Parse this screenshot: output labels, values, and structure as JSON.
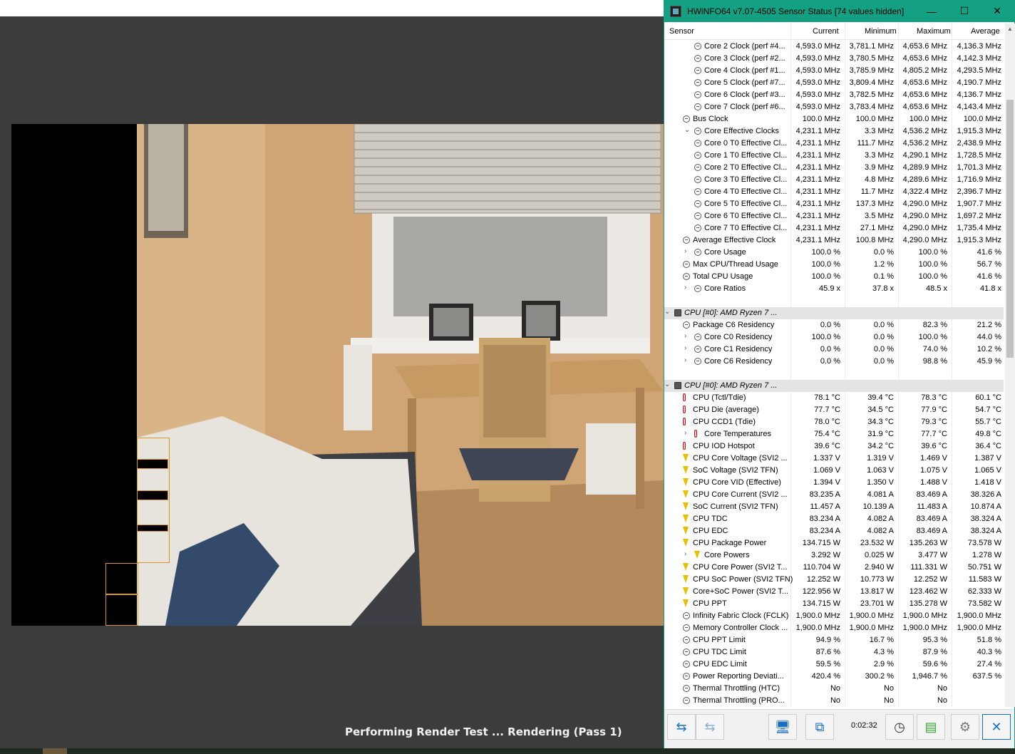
{
  "render": {
    "status_text": "Performing Render Test ... Rendering (Pass 1)"
  },
  "hwinfo": {
    "title": "HWiNFO64 v7.07-4505 Sensor Status [74 values hidden]",
    "window_controls": {
      "minimize": "—",
      "maximize": "☐",
      "close": "✕"
    },
    "columns": [
      "Sensor",
      "Current",
      "Minimum",
      "Maximum",
      "Average"
    ],
    "rows": [
      {
        "name": "Core 2 Clock (perf #4...",
        "cur": "4,593.0 MHz",
        "min": "3,781.1 MHz",
        "max": "4,653.6 MHz",
        "avg": "4,136.3 MHz",
        "indent": 2,
        "icon": "circle"
      },
      {
        "name": "Core 3 Clock (perf #2...",
        "cur": "4,593.0 MHz",
        "min": "3,780.5 MHz",
        "max": "4,653.6 MHz",
        "avg": "4,142.3 MHz",
        "indent": 2,
        "icon": "circle"
      },
      {
        "name": "Core 4 Clock (perf #1...",
        "cur": "4,593.0 MHz",
        "min": "3,785.9 MHz",
        "max": "4,805.2 MHz",
        "avg": "4,293.5 MHz",
        "indent": 2,
        "icon": "circle"
      },
      {
        "name": "Core 5 Clock (perf #7...",
        "cur": "4,593.0 MHz",
        "min": "3,809.4 MHz",
        "max": "4,653.6 MHz",
        "avg": "4,190.7 MHz",
        "indent": 2,
        "icon": "circle"
      },
      {
        "name": "Core 6 Clock (perf #3...",
        "cur": "4,593.0 MHz",
        "min": "3,782.5 MHz",
        "max": "4,653.6 MHz",
        "avg": "4,136.7 MHz",
        "indent": 2,
        "icon": "circle"
      },
      {
        "name": "Core 7 Clock (perf #6...",
        "cur": "4,593.0 MHz",
        "min": "3,783.4 MHz",
        "max": "4,653.6 MHz",
        "avg": "4,143.4 MHz",
        "indent": 2,
        "icon": "circle"
      },
      {
        "name": "Bus Clock",
        "cur": "100.0 MHz",
        "min": "100.0 MHz",
        "max": "100.0 MHz",
        "avg": "100.0 MHz",
        "indent": 1,
        "icon": "circle"
      },
      {
        "name": "Core Effective Clocks",
        "cur": "4,231.1 MHz",
        "min": "3.3 MHz",
        "max": "4,536.2 MHz",
        "avg": "1,915.3 MHz",
        "indent": 2,
        "icon": "circle",
        "exp": "⌄"
      },
      {
        "name": "Core 0 T0 Effective Cl...",
        "cur": "4,231.1 MHz",
        "min": "111.7 MHz",
        "max": "4,536.2 MHz",
        "avg": "2,438.9 MHz",
        "indent": 2,
        "icon": "circle"
      },
      {
        "name": "Core 1 T0 Effective Cl...",
        "cur": "4,231.1 MHz",
        "min": "3.3 MHz",
        "max": "4,290.1 MHz",
        "avg": "1,728.5 MHz",
        "indent": 2,
        "icon": "circle"
      },
      {
        "name": "Core 2 T0 Effective Cl...",
        "cur": "4,231.1 MHz",
        "min": "3.9 MHz",
        "max": "4,289.9 MHz",
        "avg": "1,701.3 MHz",
        "indent": 2,
        "icon": "circle"
      },
      {
        "name": "Core 3 T0 Effective Cl...",
        "cur": "4,231.1 MHz",
        "min": "4.8 MHz",
        "max": "4,289.6 MHz",
        "avg": "1,716.9 MHz",
        "indent": 2,
        "icon": "circle"
      },
      {
        "name": "Core 4 T0 Effective Cl...",
        "cur": "4,231.1 MHz",
        "min": "11.7 MHz",
        "max": "4,322.4 MHz",
        "avg": "2,396.7 MHz",
        "indent": 2,
        "icon": "circle"
      },
      {
        "name": "Core 5 T0 Effective Cl...",
        "cur": "4,231.1 MHz",
        "min": "137.3 MHz",
        "max": "4,290.0 MHz",
        "avg": "1,907.7 MHz",
        "indent": 2,
        "icon": "circle"
      },
      {
        "name": "Core 6 T0 Effective Cl...",
        "cur": "4,231.1 MHz",
        "min": "3.5 MHz",
        "max": "4,290.0 MHz",
        "avg": "1,697.2 MHz",
        "indent": 2,
        "icon": "circle"
      },
      {
        "name": "Core 7 T0 Effective Cl...",
        "cur": "4,231.1 MHz",
        "min": "27.1 MHz",
        "max": "4,290.0 MHz",
        "avg": "1,735.4 MHz",
        "indent": 2,
        "icon": "circle"
      },
      {
        "name": "Average Effective Clock",
        "cur": "4,231.1 MHz",
        "min": "100.8 MHz",
        "max": "4,290.0 MHz",
        "avg": "1,915.3 MHz",
        "indent": 1,
        "icon": "circle"
      },
      {
        "name": "Core Usage",
        "cur": "100.0 %",
        "min": "0.0 %",
        "max": "100.0 %",
        "avg": "41.6 %",
        "indent": 2,
        "icon": "circle",
        "exp": "›"
      },
      {
        "name": "Max CPU/Thread Usage",
        "cur": "100.0 %",
        "min": "1.2 %",
        "max": "100.0 %",
        "avg": "56.7 %",
        "indent": 1,
        "icon": "circle"
      },
      {
        "name": "Total CPU Usage",
        "cur": "100.0 %",
        "min": "0.1 %",
        "max": "100.0 %",
        "avg": "41.6 %",
        "indent": 1,
        "icon": "circle"
      },
      {
        "name": "Core Ratios",
        "cur": "45.9 x",
        "min": "37.8 x",
        "max": "48.5 x",
        "avg": "41.8 x",
        "indent": 2,
        "icon": "circle",
        "exp": "›"
      },
      {
        "name": "",
        "cur": "",
        "min": "",
        "max": "",
        "avg": "",
        "indent": 0,
        "icon": "none"
      },
      {
        "name": "CPU [#0]: AMD Ryzen 7 ...",
        "cur": "",
        "min": "",
        "max": "",
        "avg": "",
        "indent": 0,
        "icon": "chip",
        "exp": "⌄",
        "group": true
      },
      {
        "name": "Package C6 Residency",
        "cur": "0.0 %",
        "min": "0.0 %",
        "max": "82.3 %",
        "avg": "21.2 %",
        "indent": 1,
        "icon": "circle"
      },
      {
        "name": "Core C0 Residency",
        "cur": "100.0 %",
        "min": "0.0 %",
        "max": "100.0 %",
        "avg": "44.0 %",
        "indent": 2,
        "icon": "circle",
        "exp": "›"
      },
      {
        "name": "Core C1 Residency",
        "cur": "0.0 %",
        "min": "0.0 %",
        "max": "74.0 %",
        "avg": "10.2 %",
        "indent": 2,
        "icon": "circle",
        "exp": "›"
      },
      {
        "name": "Core C6 Residency",
        "cur": "0.0 %",
        "min": "0.0 %",
        "max": "98.8 %",
        "avg": "45.9 %",
        "indent": 2,
        "icon": "circle",
        "exp": "›"
      },
      {
        "name": "",
        "cur": "",
        "min": "",
        "max": "",
        "avg": "",
        "indent": 0,
        "icon": "none"
      },
      {
        "name": "CPU [#0]: AMD Ryzen 7 ...",
        "cur": "",
        "min": "",
        "max": "",
        "avg": "",
        "indent": 0,
        "icon": "chip",
        "exp": "⌄",
        "group": true
      },
      {
        "name": "CPU (Tctl/Tdie)",
        "cur": "78.1 °C",
        "min": "39.4 °C",
        "max": "78.3 °C",
        "avg": "60.1 °C",
        "indent": 1,
        "icon": "temp"
      },
      {
        "name": "CPU Die (average)",
        "cur": "77.7 °C",
        "min": "34.5 °C",
        "max": "77.9 °C",
        "avg": "54.7 °C",
        "indent": 1,
        "icon": "temp"
      },
      {
        "name": "CPU CCD1 (Tdie)",
        "cur": "78.0 °C",
        "min": "34.3 °C",
        "max": "79.3 °C",
        "avg": "55.7 °C",
        "indent": 1,
        "icon": "temp"
      },
      {
        "name": "Core Temperatures",
        "cur": "75.4 °C",
        "min": "31.9 °C",
        "max": "77.7 °C",
        "avg": "49.8 °C",
        "indent": 2,
        "icon": "temp",
        "exp": "›"
      },
      {
        "name": "CPU IOD Hotspot",
        "cur": "39.6 °C",
        "min": "34.2 °C",
        "max": "39.6 °C",
        "avg": "36.4 °C",
        "indent": 1,
        "icon": "temp"
      },
      {
        "name": "CPU Core Voltage (SVI2 ...",
        "cur": "1.337 V",
        "min": "1.319 V",
        "max": "1.469 V",
        "avg": "1.387 V",
        "indent": 1,
        "icon": "volt"
      },
      {
        "name": "SoC Voltage (SVI2 TFN)",
        "cur": "1.069 V",
        "min": "1.063 V",
        "max": "1.075 V",
        "avg": "1.065 V",
        "indent": 1,
        "icon": "volt"
      },
      {
        "name": "CPU Core VID (Effective)",
        "cur": "1.394 V",
        "min": "1.350 V",
        "max": "1.488 V",
        "avg": "1.418 V",
        "indent": 1,
        "icon": "volt"
      },
      {
        "name": "CPU Core Current (SVI2 ...",
        "cur": "83.235 A",
        "min": "4.081 A",
        "max": "83.469 A",
        "avg": "38.326 A",
        "indent": 1,
        "icon": "volt"
      },
      {
        "name": "SoC Current (SVI2 TFN)",
        "cur": "11.457 A",
        "min": "10.139 A",
        "max": "11.483 A",
        "avg": "10.874 A",
        "indent": 1,
        "icon": "volt"
      },
      {
        "name": "CPU TDC",
        "cur": "83.234 A",
        "min": "4.082 A",
        "max": "83.469 A",
        "avg": "38.324 A",
        "indent": 1,
        "icon": "volt"
      },
      {
        "name": "CPU EDC",
        "cur": "83.234 A",
        "min": "4.082 A",
        "max": "83.469 A",
        "avg": "38.324 A",
        "indent": 1,
        "icon": "volt"
      },
      {
        "name": "CPU Package Power",
        "cur": "134.715 W",
        "min": "23.532 W",
        "max": "135.263 W",
        "avg": "73.578 W",
        "indent": 1,
        "icon": "volt"
      },
      {
        "name": "Core Powers",
        "cur": "3.292 W",
        "min": "0.025 W",
        "max": "3.477 W",
        "avg": "1.278 W",
        "indent": 2,
        "icon": "volt",
        "exp": "›"
      },
      {
        "name": "CPU Core Power (SVI2 T...",
        "cur": "110.704 W",
        "min": "2.940 W",
        "max": "111.331 W",
        "avg": "50.751 W",
        "indent": 1,
        "icon": "volt"
      },
      {
        "name": "CPU SoC Power (SVI2 TFN)",
        "cur": "12.252 W",
        "min": "10.773 W",
        "max": "12.252 W",
        "avg": "11.583 W",
        "indent": 1,
        "icon": "volt"
      },
      {
        "name": "Core+SoC Power (SVI2 T...",
        "cur": "122.956 W",
        "min": "13.817 W",
        "max": "123.462 W",
        "avg": "62.333 W",
        "indent": 1,
        "icon": "volt"
      },
      {
        "name": "CPU PPT",
        "cur": "134.715 W",
        "min": "23.701 W",
        "max": "135.278 W",
        "avg": "73.582 W",
        "indent": 1,
        "icon": "volt"
      },
      {
        "name": "Infinity Fabric Clock (FCLK)",
        "cur": "1,900.0 MHz",
        "min": "1,900.0 MHz",
        "max": "1,900.0 MHz",
        "avg": "1,900.0 MHz",
        "indent": 1,
        "icon": "circle"
      },
      {
        "name": "Memory Controller Clock ...",
        "cur": "1,900.0 MHz",
        "min": "1,900.0 MHz",
        "max": "1,900.0 MHz",
        "avg": "1,900.0 MHz",
        "indent": 1,
        "icon": "circle"
      },
      {
        "name": "CPU PPT Limit",
        "cur": "94.9 %",
        "min": "16.7 %",
        "max": "95.3 %",
        "avg": "51.8 %",
        "indent": 1,
        "icon": "circle"
      },
      {
        "name": "CPU TDC Limit",
        "cur": "87.6 %",
        "min": "4.3 %",
        "max": "87.9 %",
        "avg": "40.3 %",
        "indent": 1,
        "icon": "circle"
      },
      {
        "name": "CPU EDC Limit",
        "cur": "59.5 %",
        "min": "2.9 %",
        "max": "59.6 %",
        "avg": "27.4 %",
        "indent": 1,
        "icon": "circle"
      },
      {
        "name": "Power Reporting Deviati...",
        "cur": "420.4 %",
        "min": "300.2 %",
        "max": "1,946.7 %",
        "avg": "637.5 %",
        "indent": 1,
        "icon": "circle"
      },
      {
        "name": "Thermal Throttling (HTC)",
        "cur": "No",
        "min": "No",
        "max": "No",
        "avg": "",
        "indent": 1,
        "icon": "circle"
      },
      {
        "name": "Thermal Throttling (PRO...",
        "cur": "No",
        "min": "No",
        "max": "No",
        "avg": "",
        "indent": 1,
        "icon": "circle"
      }
    ],
    "toolbar": {
      "timer": "0:02:32"
    }
  }
}
